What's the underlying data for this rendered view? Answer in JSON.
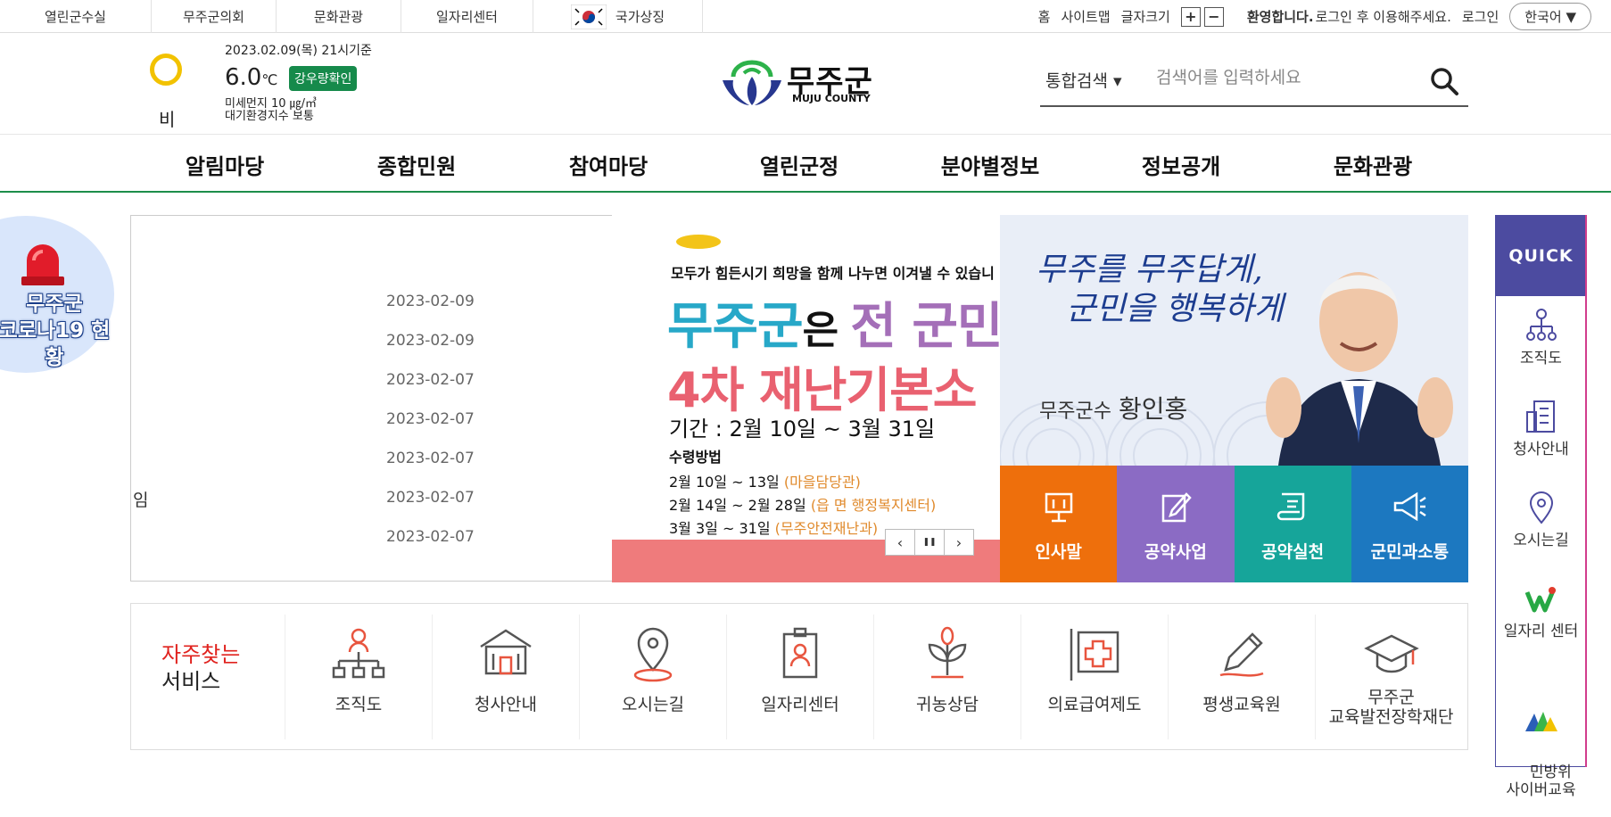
{
  "topbar": {
    "links": [
      "열린군수실",
      "무주군의회",
      "문화관광",
      "일자리센터"
    ],
    "national_symbol": "국가상징",
    "home": "홈",
    "sitemap": "사이트맵",
    "font_size": "글자크기",
    "welcome_bold": "환영합니다.",
    "welcome_text": "로그인 후 이용해주세요.",
    "login": "로그인",
    "language": "한국어 ▼"
  },
  "weather": {
    "date": "2023.02.09(목) 21시기준",
    "temp": "6.0",
    "unit": "℃",
    "rain_button": "강우량확인",
    "condition": "비",
    "dust": "미세먼지 10 ㎍/㎥\n대기환경지수 보통"
  },
  "logo": {
    "kr": "무주군",
    "en": "MUJU COUNTY"
  },
  "search": {
    "select": "통합검색  ▾",
    "placeholder": "검색어를 입력하세요"
  },
  "gnb": [
    "알림마당",
    "종합민원",
    "참여마당",
    "열린군정",
    "분야별정보",
    "정보공개",
    "문화관광"
  ],
  "covid": {
    "label_line1": "무주군",
    "label_line2": "코로나19 현황"
  },
  "news": {
    "dates": [
      "2023-02-09",
      "2023-02-09",
      "2023-02-07",
      "2023-02-07",
      "2023-02-07",
      "2023-02-07",
      "2023-02-07"
    ],
    "partial_text": "임"
  },
  "banner": {
    "line1": "모두가 힘든시기 희망을 함께 나누면 이겨낼 수 있습니",
    "big1_a": "무주군",
    "big1_b": "은 ",
    "big1_c": "전 군민",
    "big2": "4차 재난기본소",
    "period": "기간 : 2월 10일 ~ 3월 31일",
    "how": "수령방법",
    "rows": [
      {
        "date": "2월 10일  ~  13일",
        "place": "(마을담당관)"
      },
      {
        "date": "2월 14일  ~  2월 28일",
        "place": "(읍 면 행정복지센터)"
      },
      {
        "date": "3월   3일  ~  31일",
        "place": "(무주안전재난과)"
      }
    ],
    "controls": [
      "‹",
      "❚❚",
      "›"
    ]
  },
  "mayor": {
    "slogan": "무주를 무주답게,\n   군민을 행복하게",
    "title": "무주군수",
    "name": "황인홍"
  },
  "tiles": [
    {
      "label": "인사말",
      "color": "#ee6f0c",
      "icon": "podium-icon"
    },
    {
      "label": "공약사업",
      "color": "#8b6bc4",
      "icon": "document-edit-icon"
    },
    {
      "label": "공약실천",
      "color": "#16a59a",
      "icon": "scroll-icon"
    },
    {
      "label": "군민과소통",
      "color": "#1c78c0",
      "icon": "megaphone-icon"
    }
  ],
  "quick": {
    "title": "QUICK",
    "items": [
      "조직도",
      "청사안내",
      "오시는길",
      "일자리 센터",
      "민방위\n사이버교육"
    ]
  },
  "favs": {
    "title_red": "자주찾는",
    "title_black": "서비스",
    "items": [
      "조직도",
      "청사안내",
      "오시는길",
      "일자리센터",
      "귀농상담",
      "의료급여제도",
      "평생교육원",
      "무주군\n교육발전장학재단"
    ]
  }
}
